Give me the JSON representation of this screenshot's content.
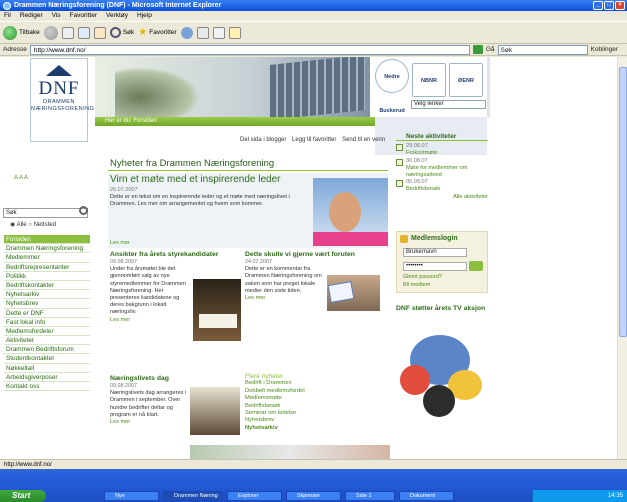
{
  "window": {
    "title": "Drammen Næringsforening (DNF) - Microsoft Internet Explorer"
  },
  "menu": [
    "Fil",
    "Rediger",
    "Vis",
    "Favoritter",
    "Verktøy",
    "Hjelp"
  ],
  "toolbar": {
    "back_label": "Tilbake",
    "search_label": "Søk",
    "favorites_label": "Favoritter"
  },
  "address": {
    "label": "Adresse",
    "url": "http://www.dnf.no/",
    "go": "Gå",
    "links": "Koblinger",
    "search_box": "Søk"
  },
  "left": {
    "logo_text": "DNF",
    "logo_sub": "DRAMMEN NÆRINGSFORENING",
    "font_control": "A A A",
    "search_label": "Søk",
    "radio_options": [
      "Alle",
      "Nettsted"
    ],
    "nav": [
      "Forsiden",
      "Drammen Næringsforening",
      "Medlemmer",
      "Bedriftsrepresentanter",
      "Politikk",
      "Bedriftskontakter",
      "Nyhetsarkiv",
      "Nyhetsbrev",
      "Dette er DNF",
      "Fast lokal info",
      "Medlemsfordeler",
      "Aktiviteter",
      "Drammen Bedriftsforum",
      "Studentkontakter",
      "Nøkkeltall",
      "Arbeidsgiverposer",
      "Kontakt oss"
    ]
  },
  "header": {
    "breadcrumb": "Her er du: Forsiden",
    "selector": "Velg lenker",
    "logos": [
      "Nedre Buskerud",
      "NBNR",
      "ØENR"
    ]
  },
  "utility": [
    "Del sida i blogger",
    "Legg til favoritter",
    "Send til en venn"
  ],
  "main": {
    "heading": "Nyheter fra Drammen Næringsforening",
    "feature": {
      "title": "Virn et møte med et inspirerende leder",
      "date": "26.07.2007",
      "text": "Dette er en tekst om en inspirerende leder og et møte med næringslivet i Drammen. Les mer om arrangementet og hvem som kommer.",
      "more": "Les mer"
    },
    "col1": {
      "title": "Ansikter fra årets styrekandidater",
      "date": "09.08.2007",
      "text": "Under fra årsmøtet ble det gjennomført valg av nye styremedlemmer for Drammen Næringsforening. Her presenteres kandidatene og deres bakgrunn i lokalt næringsliv.",
      "more": "Les mer"
    },
    "col2": {
      "title": "Dette skulle vi gjerne vært foruten",
      "date": "24.07.2007",
      "text": "Dette er en kommentar fra Drammen Næringsforening om saken som har preget lokale medier den siste tiden.",
      "more": "Les mer"
    },
    "col3": {
      "title": "Næringslivets dag",
      "date": "09.08.2007",
      "text": "Næringslivets dag arrangeres i Drammen i september. Over hundre bedrifter deltar og program er nå klart.",
      "more": "Les mer"
    },
    "tips": {
      "title": "Flere nyheter",
      "items": [
        "Bedrift i Drammen",
        "Dobbelt medlemsfordel",
        "Medlemsmøte",
        "Bedriftsbesøk",
        "Seminar om ledelse",
        "Nyhetsbrev"
      ],
      "more": "Nyhetsarkiv"
    }
  },
  "side": {
    "heading": "Neste aktiviteter",
    "events": [
      {
        "date": "29.08.07",
        "text": "Frokostmøte"
      },
      {
        "date": "30.08.07",
        "text": "Møte for medlemmer om næringsarbeid"
      },
      {
        "date": "05.09.07",
        "text": "Bedriftsbesøk"
      }
    ],
    "all": "Alle aktiviteter",
    "login": {
      "title": "Medlemslogin",
      "user": "Brukernavn",
      "pass": "••••••••",
      "forgot": "Glemt passord?",
      "register": "Bli medlem"
    },
    "tv": "DNF støtter årets TV aksjon"
  },
  "status": {
    "text": "http://www.dnf.no/"
  },
  "taskbar": {
    "start": "Start",
    "tasks": [
      "Nye",
      "Drammen Næring",
      "Explorer",
      "Skjemaer",
      "Side 1",
      "Dokument"
    ],
    "clock": "14:35"
  }
}
